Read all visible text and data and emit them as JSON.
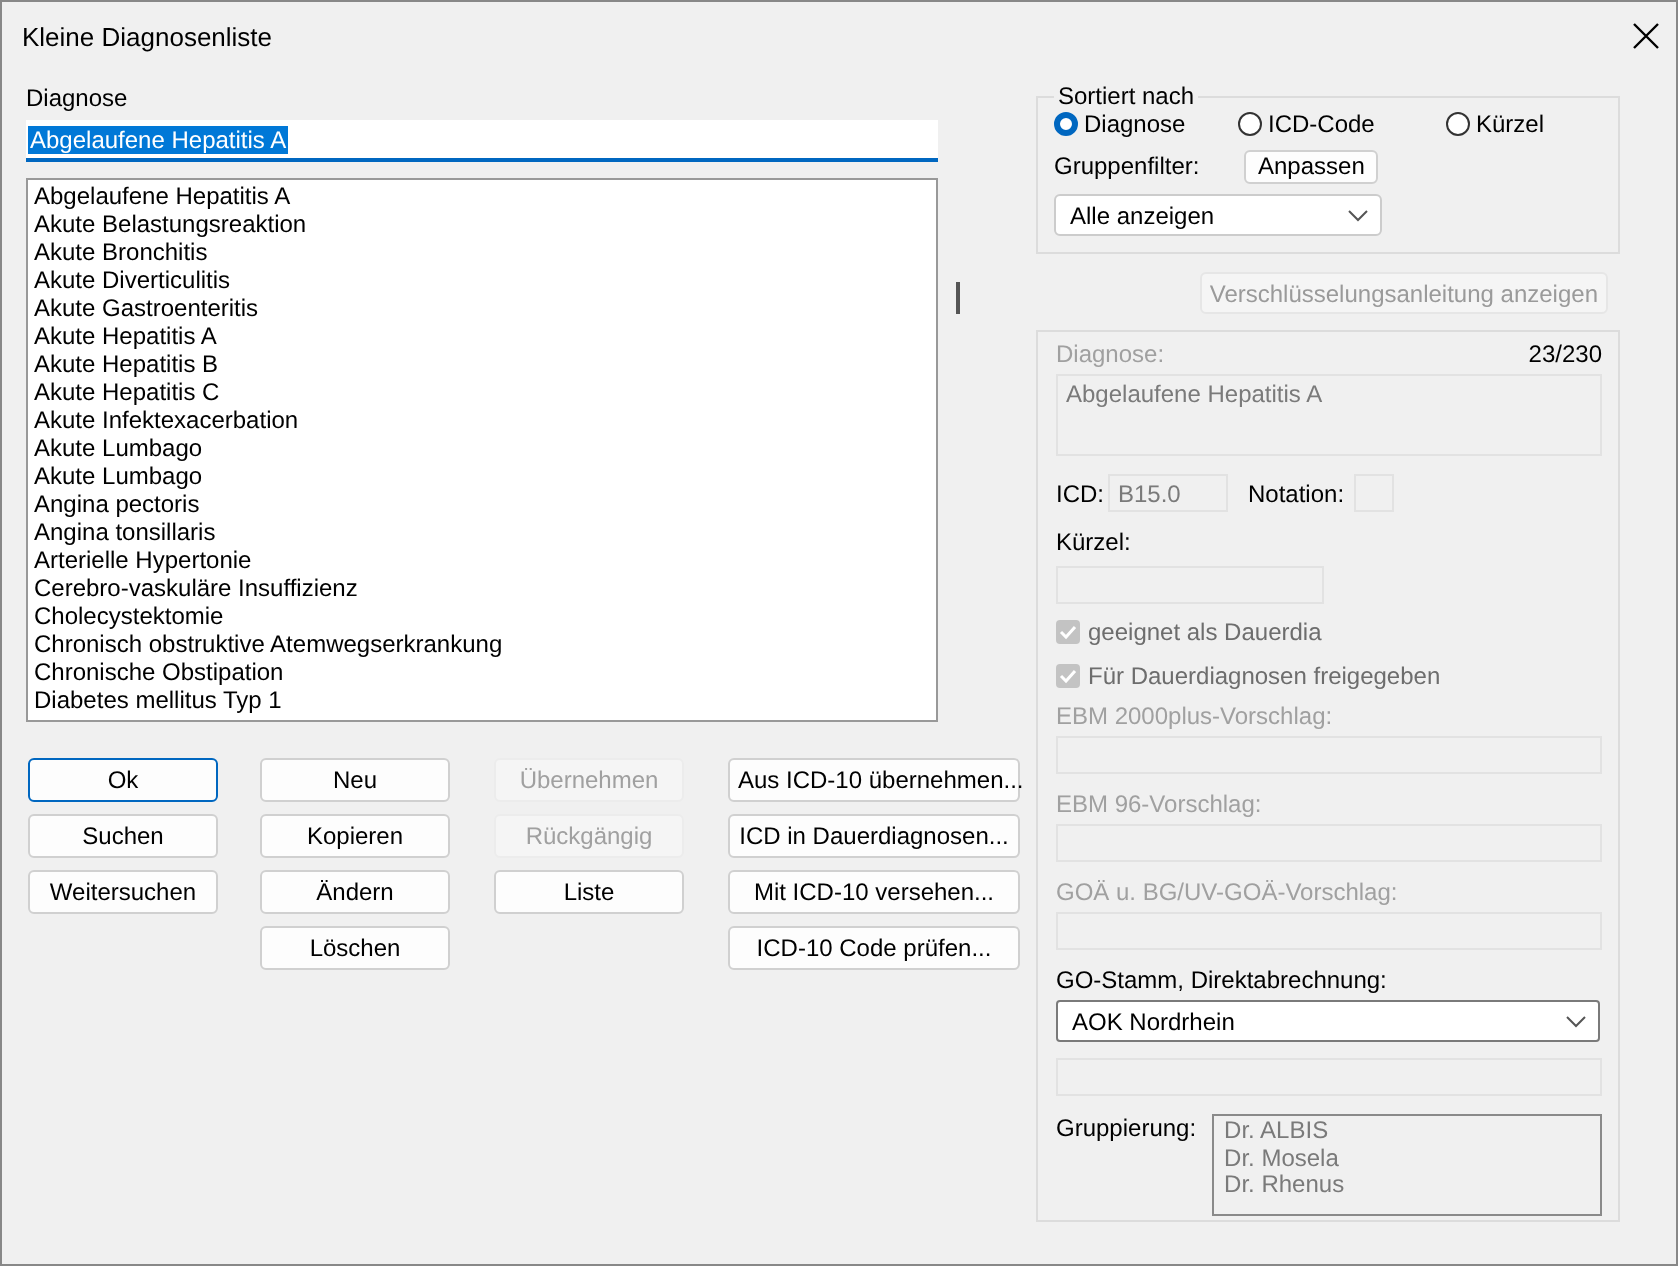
{
  "window": {
    "title": "Kleine Diagnosenliste"
  },
  "diagnosis_field": {
    "label": "Diagnose",
    "value": "Abgelaufene Hepatitis A"
  },
  "diagnosis_list": [
    "Abgelaufene Hepatitis A",
    "Akute Belastungsreaktion",
    "Akute Bronchitis",
    "Akute Diverticulitis",
    "Akute Gastroenteritis",
    "Akute Hepatitis A",
    "Akute Hepatitis B",
    "Akute Hepatitis C",
    "Akute Infektexacerbation",
    "Akute Lumbago",
    "Akute Lumbago",
    "Angina pectoris",
    "Angina tonsillaris",
    "Arterielle Hypertonie",
    "Cerebro-vaskuläre Insuffizienz",
    "Cholecystektomie",
    "Chronisch obstruktive Atemwegserkrankung",
    "Chronische Obstipation",
    "Diabetes mellitus Typ 1"
  ],
  "button_columns": [
    [
      {
        "label": "Ok",
        "default": true,
        "disabled": false
      },
      {
        "label": "Suchen",
        "default": false,
        "disabled": false
      },
      {
        "label": "Weitersuchen",
        "default": false,
        "disabled": false
      }
    ],
    [
      {
        "label": "Neu",
        "default": false,
        "disabled": false
      },
      {
        "label": "Kopieren",
        "default": false,
        "disabled": false
      },
      {
        "label": "Ändern",
        "default": false,
        "disabled": false
      },
      {
        "label": "Löschen",
        "default": false,
        "disabled": false
      }
    ],
    [
      {
        "label": "Übernehmen",
        "default": false,
        "disabled": true
      },
      {
        "label": "Rückgängig",
        "default": false,
        "disabled": true
      },
      {
        "label": "Liste",
        "default": false,
        "disabled": false
      }
    ],
    [
      {
        "label": "Aus ICD-10 übernehmen...",
        "default": false,
        "disabled": false
      },
      {
        "label": "ICD in Dauerdiagnosen...",
        "default": false,
        "disabled": false
      },
      {
        "label": "Mit ICD-10 versehen...",
        "default": false,
        "disabled": false
      },
      {
        "label": "ICD-10 Code prüfen...",
        "default": false,
        "disabled": false
      }
    ]
  ],
  "sort": {
    "title": "Sortiert nach",
    "options": [
      {
        "label": "Diagnose",
        "selected": true
      },
      {
        "label": "ICD-Code",
        "selected": false
      },
      {
        "label": "Kürzel",
        "selected": false
      }
    ],
    "filter_label": "Gruppenfilter:",
    "filter_button": "Anpassen",
    "filter_value": "Alle anzeigen"
  },
  "guide_button": {
    "label": "Verschlüsselungsanleitung anzeigen",
    "disabled": true
  },
  "details": {
    "diagnosis_label": "Diagnose:",
    "counter": "23/230",
    "diagnosis_value": "Abgelaufene Hepatitis A",
    "icd_label": "ICD:",
    "icd_value": "B15.0",
    "notation_label": "Notation:",
    "short_label": "Kürzel:",
    "checkboxes": [
      {
        "label": "geeignet als Dauerdia",
        "checked": true
      },
      {
        "label": "Für Dauerdiagnosen freigegeben",
        "checked": true
      }
    ],
    "proposals": [
      "EBM 2000plus-Vorschlag:",
      "EBM 96-Vorschlag:",
      "GOÄ u. BG/UV-GOÄ-Vorschlag:"
    ],
    "go_label": "GO-Stamm, Direktabrechnung:",
    "go_value": "AOK Nordrhein",
    "grouping_label": "Gruppierung:",
    "grouping_items": [
      "Dr. ALBIS",
      "Dr. Mosela",
      "Dr. Rhenus"
    ]
  }
}
